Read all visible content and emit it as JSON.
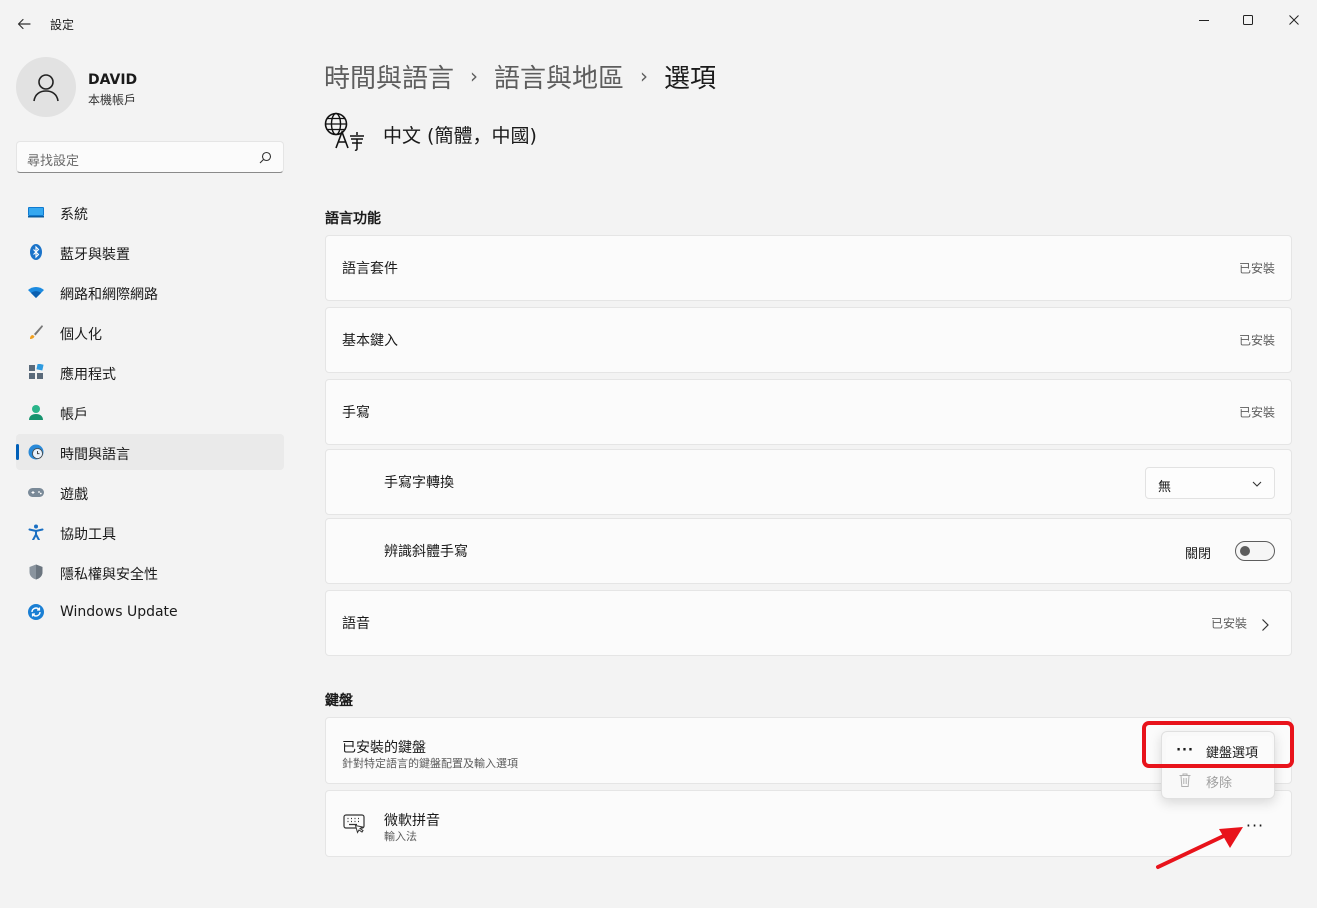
{
  "window": {
    "title": "設定"
  },
  "profile": {
    "name": "DAVID",
    "account_type": "本機帳戶"
  },
  "search": {
    "placeholder": "尋找設定"
  },
  "sidebar": {
    "items": [
      {
        "label": "系統",
        "icon": "system-icon"
      },
      {
        "label": "藍牙與裝置",
        "icon": "bluetooth-icon"
      },
      {
        "label": "網路和網際網路",
        "icon": "wifi-icon"
      },
      {
        "label": "個人化",
        "icon": "brush-icon"
      },
      {
        "label": "應用程式",
        "icon": "apps-icon"
      },
      {
        "label": "帳戶",
        "icon": "person-icon"
      },
      {
        "label": "時間與語言",
        "icon": "globe-clock-icon",
        "active": true
      },
      {
        "label": "遊戲",
        "icon": "gamepad-icon"
      },
      {
        "label": "協助工具",
        "icon": "accessibility-icon"
      },
      {
        "label": "隱私權與安全性",
        "icon": "shield-icon"
      },
      {
        "label": "Windows Update",
        "icon": "update-icon"
      }
    ]
  },
  "breadcrumb": {
    "level1": "時間與語言",
    "level2": "語言與地區",
    "current": "選項",
    "separator": "›"
  },
  "language": {
    "title": "中文 (簡體，中國)"
  },
  "sections": {
    "features_title": "語言功能",
    "keyboard_title": "鍵盤"
  },
  "features": {
    "language_pack": {
      "label": "語言套件",
      "status": "已安裝"
    },
    "basic_typing": {
      "label": "基本鍵入",
      "status": "已安裝"
    },
    "handwriting": {
      "label": "手寫",
      "status": "已安裝"
    },
    "handwriting_conversion": {
      "label": "手寫字轉換",
      "value": "無"
    },
    "italic_handwriting": {
      "label": "辨識斜體手寫",
      "toggle_label": "關閉",
      "toggle_on": false
    },
    "speech": {
      "label": "語音",
      "status": "已安裝"
    }
  },
  "keyboard": {
    "installed": {
      "label": "已安裝的鍵盤",
      "sublabel": "針對特定語言的鍵盤配置及輸入選項"
    },
    "ime": {
      "label": "微軟拼音",
      "sublabel": "輸入法",
      "more": "···"
    }
  },
  "context_menu": {
    "item1": {
      "label": "鍵盤選項",
      "icon": "more-icon",
      "glyph": "···"
    },
    "item2": {
      "label": "移除",
      "icon": "trash-icon",
      "enabled": false
    }
  },
  "colors": {
    "accent": "#005fb8",
    "highlight": "#e8131b",
    "background": "#f3f3f3",
    "card": "#fbfbfb"
  }
}
